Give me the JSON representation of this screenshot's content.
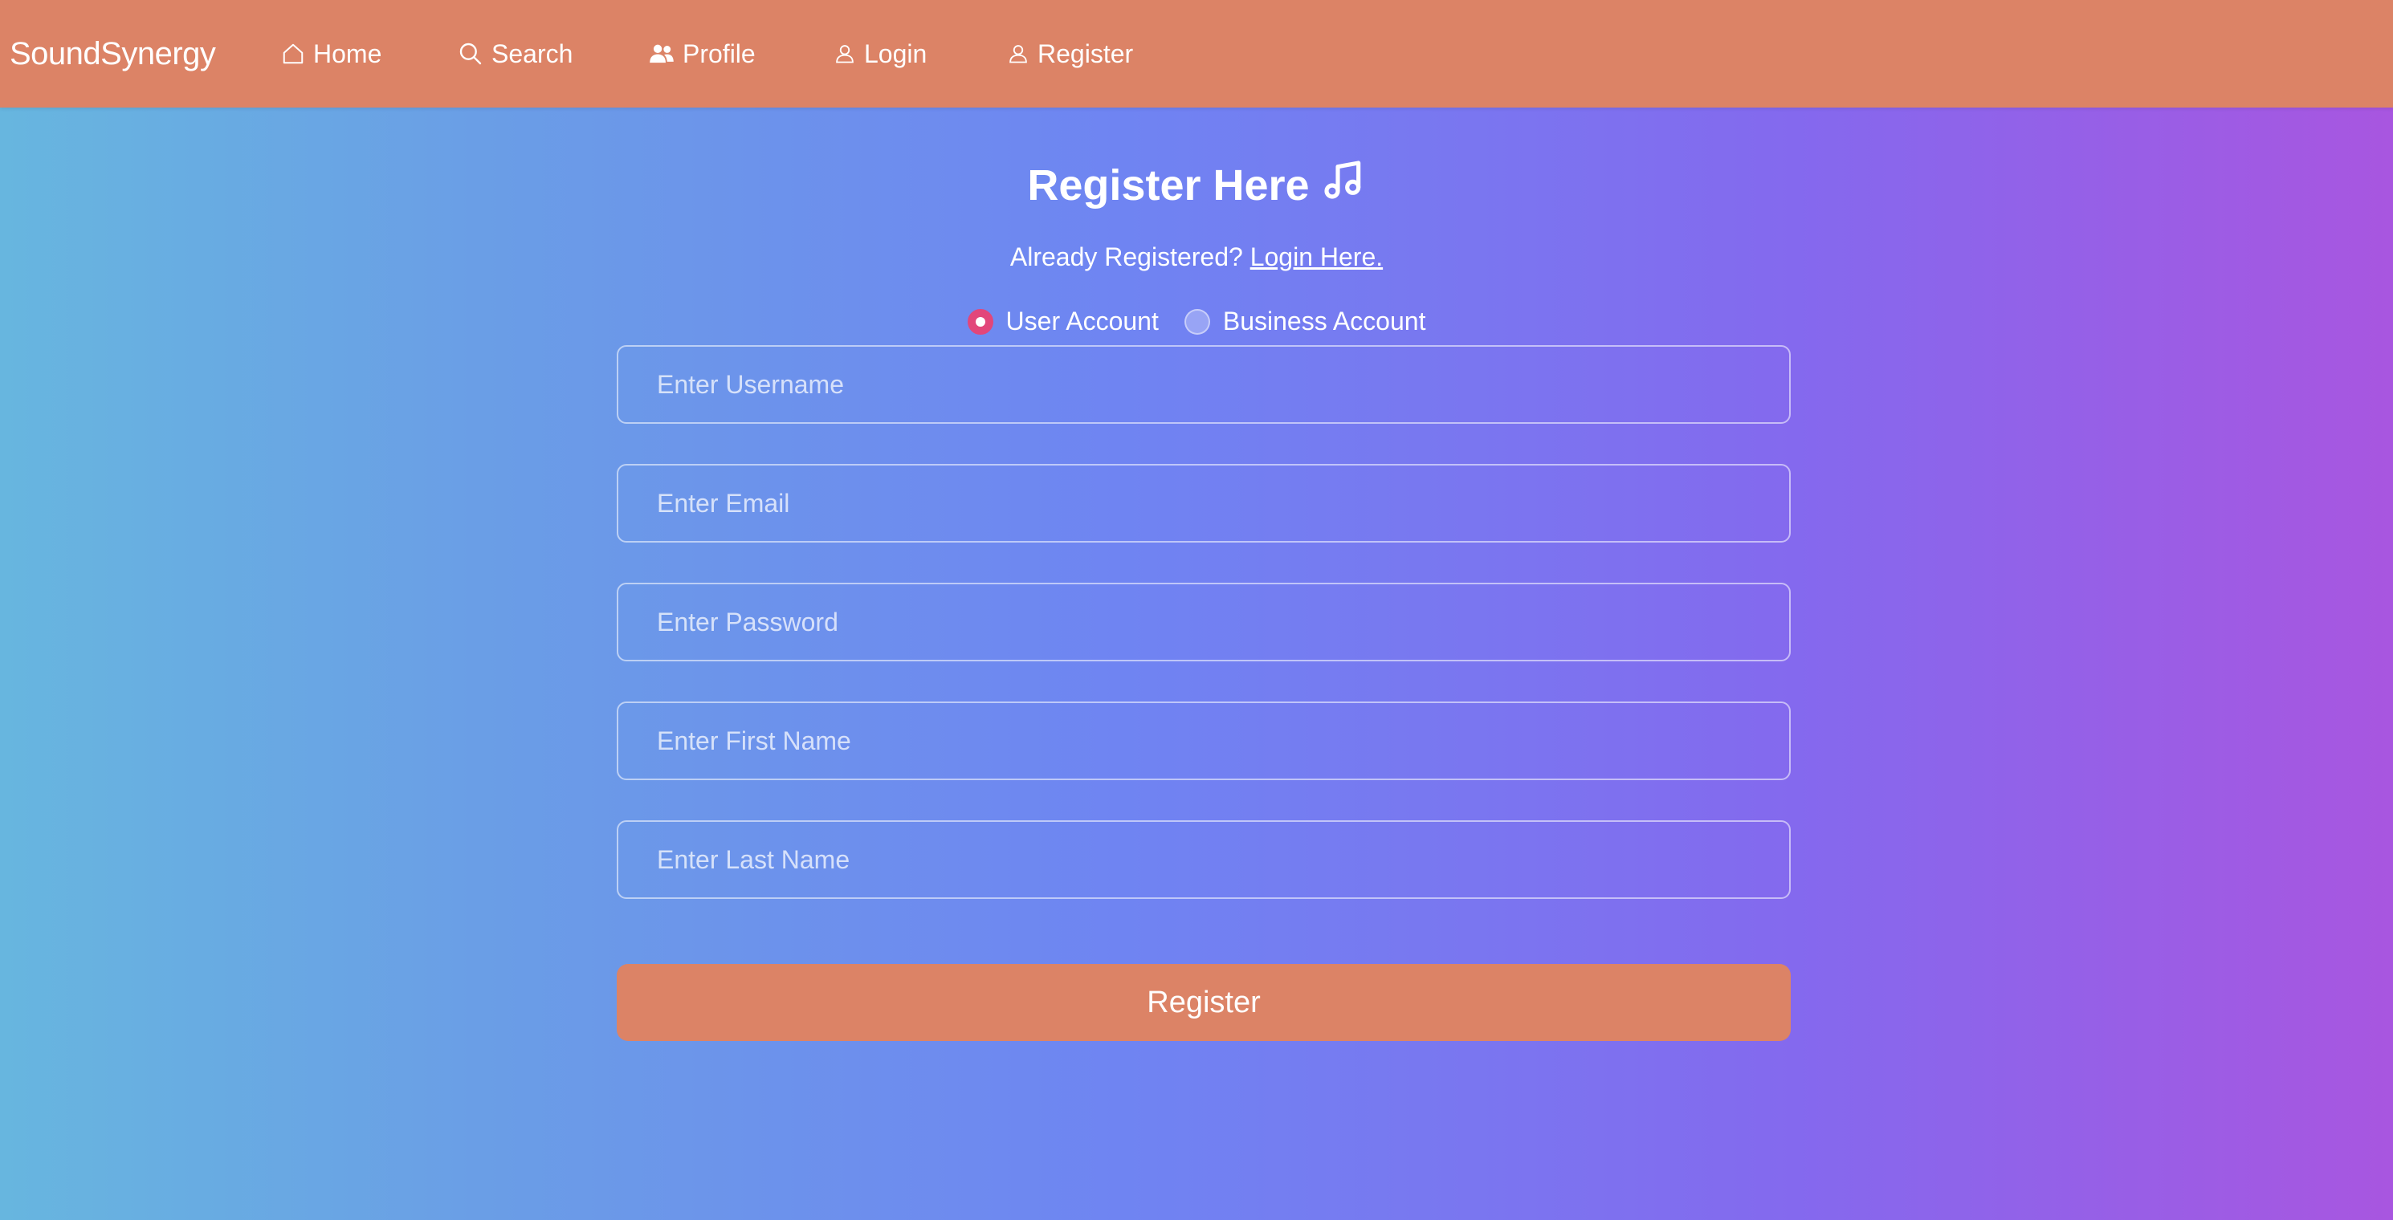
{
  "nav": {
    "brand": "SoundSynergy",
    "items": [
      {
        "label": "Home",
        "icon": "home-icon"
      },
      {
        "label": "Search",
        "icon": "search-icon"
      },
      {
        "label": "Profile",
        "icon": "users-icon"
      },
      {
        "label": "Login",
        "icon": "user-icon"
      },
      {
        "label": "Register",
        "icon": "user-icon"
      }
    ]
  },
  "form": {
    "title": "Register Here",
    "title_icon": "music-note-icon",
    "already_text": "Already Registered?",
    "login_link": "Login Here.",
    "account_types": [
      {
        "label": "User Account",
        "checked": true
      },
      {
        "label": "Business Account",
        "checked": false
      }
    ],
    "fields": [
      {
        "placeholder": "Enter Username",
        "value": ""
      },
      {
        "placeholder": "Enter Email",
        "value": ""
      },
      {
        "placeholder": "Enter Password",
        "value": ""
      },
      {
        "placeholder": "Enter First Name",
        "value": ""
      },
      {
        "placeholder": "Enter Last Name",
        "value": ""
      }
    ],
    "submit_label": "Register"
  },
  "colors": {
    "navbar": "#dc8366",
    "button": "#dc8366",
    "radio_checked": "#e2467a",
    "gradient_start": "#67b6df",
    "gradient_mid": "#6f84f2",
    "gradient_end": "#a856e0"
  }
}
